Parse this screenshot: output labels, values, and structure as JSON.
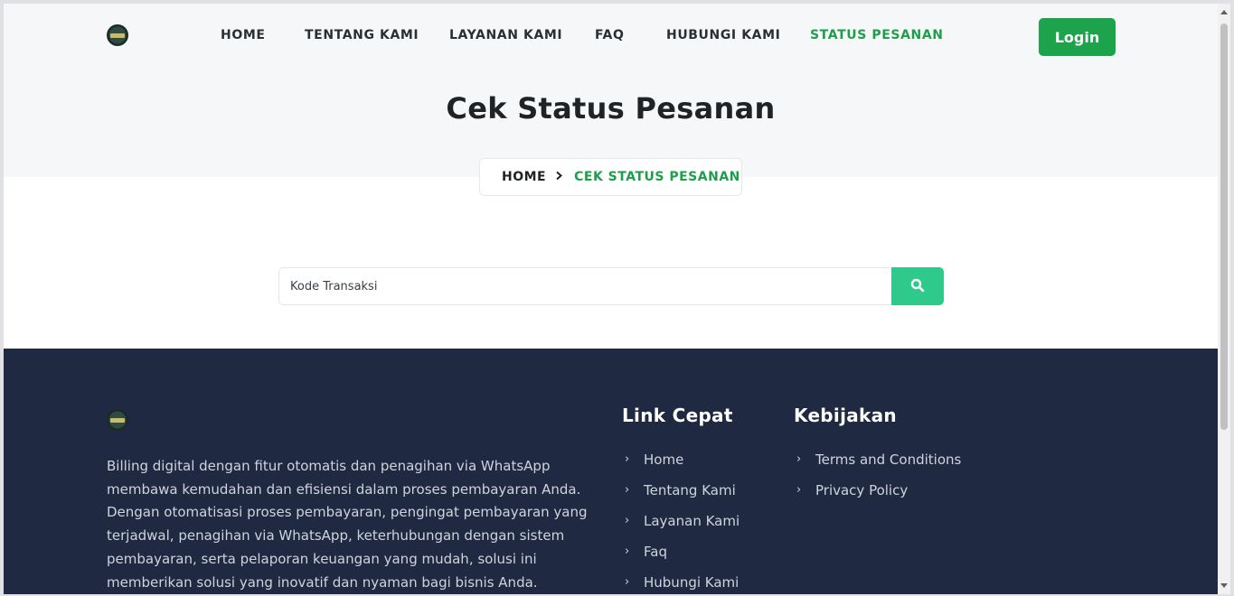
{
  "header": {
    "logo_icon": "company-logo",
    "nav": [
      {
        "label": "HOME",
        "active": false
      },
      {
        "label": "TENTANG KAMI",
        "active": false
      },
      {
        "label": "LAYANAN KAMI",
        "active": false
      },
      {
        "label": "FAQ",
        "active": false
      },
      {
        "label": "HUBUNGI KAMI",
        "active": false
      },
      {
        "label": "STATUS PESANAN",
        "active": true
      }
    ],
    "login_label": "Login"
  },
  "hero": {
    "title": "Cek Status Pesanan",
    "breadcrumb": {
      "home": "HOME",
      "separator_icon": "chevron-right-icon",
      "current": "CEK STATUS PESANAN"
    }
  },
  "search": {
    "placeholder": "Kode Transaksi",
    "value": "",
    "button_icon": "search-icon"
  },
  "footer": {
    "about": "Billing digital dengan fitur otomatis dan penagihan via WhatsApp membawa kemudahan dan efisiensi dalam proses pembayaran Anda. Dengan otomatisasi proses pembayaran, pengingat pembayaran yang terjadwal, penagihan via WhatsApp, keterhubungan dengan sistem pembayaran, serta pelaporan keuangan yang mudah, solusi ini memberikan solusi yang inovatif dan nyaman bagi bisnis Anda.",
    "quick_links": {
      "title": "Link Cepat",
      "items": [
        "Home",
        "Tentang Kami",
        "Layanan Kami",
        "Faq",
        "Hubungi Kami"
      ]
    },
    "policy": {
      "title": "Kebijakan",
      "items": [
        "Terms and Conditions",
        "Privacy Policy"
      ]
    }
  },
  "colors": {
    "accent_green": "#1ea34d",
    "search_button": "#2ec98b",
    "footer_bg": "#1f2941",
    "hero_bg": "#f5f7f9"
  }
}
